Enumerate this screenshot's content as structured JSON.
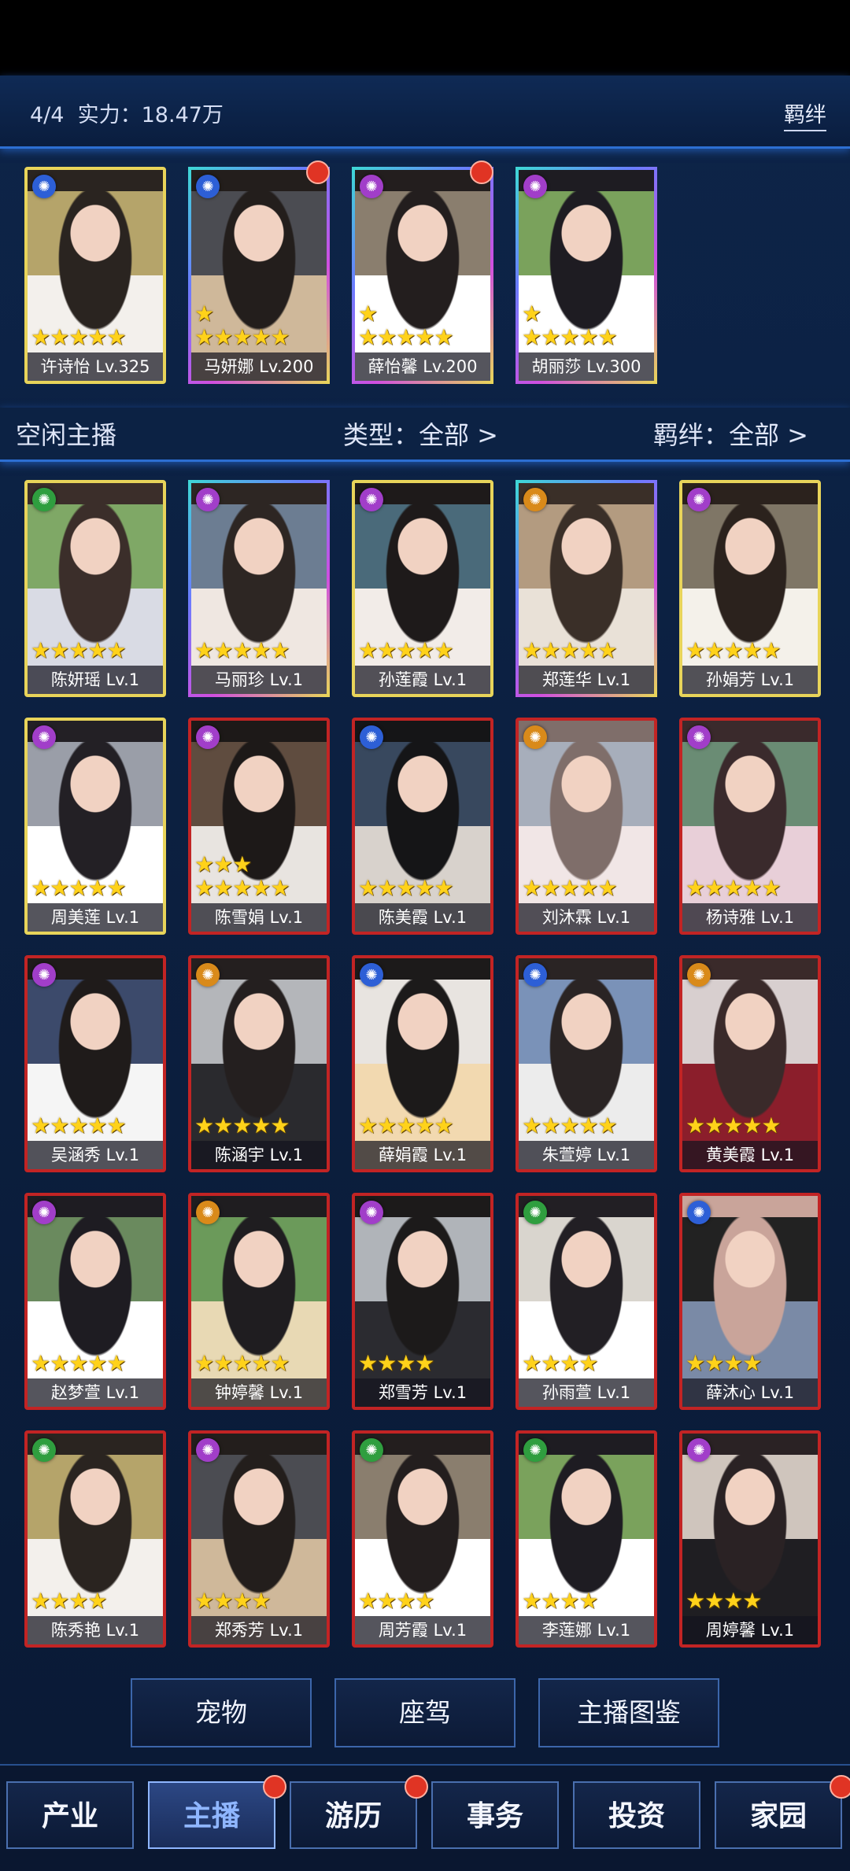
{
  "header": {
    "count": "4/4",
    "power": "实力：18.47万",
    "bond_button": "羁绊"
  },
  "filter": {
    "title": "空闲主播",
    "type": "类型：全部 >",
    "bond": "羁绊：全部 >"
  },
  "colors": {
    "star": "#ffd21a",
    "active_tab": "#8fb6ff",
    "accent_line": "#2d6fd2",
    "badge": "#e03424"
  },
  "assigned": [
    {
      "name": "许诗怡 Lv.325",
      "stars": "★★★★★",
      "element": "blue-element-icon",
      "frame": "gold",
      "badge": false
    },
    {
      "name": "马妍娜 Lv.200",
      "stars": "★\n★★★★★",
      "element": "blue-element-icon",
      "frame": "multi",
      "badge": true
    },
    {
      "name": "薛怡馨 Lv.200",
      "stars": "★\n★★★★★",
      "element": "purple-element-icon",
      "frame": "multi",
      "badge": true
    },
    {
      "name": "胡丽莎 Lv.300",
      "stars": "★\n★★★★★",
      "element": "purple-element-icon",
      "frame": "multi",
      "badge": false
    }
  ],
  "idle": [
    {
      "name": "陈妍瑶 Lv.1",
      "stars": "★★★★★",
      "element": "green",
      "frame": "gold"
    },
    {
      "name": "马丽珍 Lv.1",
      "stars": "★★★★★",
      "element": "purple",
      "frame": "multi"
    },
    {
      "name": "孙莲霞 Lv.1",
      "stars": "★★★★★",
      "element": "purple",
      "frame": "gold"
    },
    {
      "name": "郑莲华 Lv.1",
      "stars": "★★★★★",
      "element": "orange",
      "frame": "multi"
    },
    {
      "name": "孙娟芳 Lv.1",
      "stars": "★★★★★",
      "element": "purple",
      "frame": "gold"
    },
    {
      "name": "周美莲 Lv.1",
      "stars": "★★★★★",
      "element": "purple",
      "frame": "gold"
    },
    {
      "name": "陈雪娟 Lv.1",
      "stars": "★★★\n★★★★★",
      "element": "purple",
      "frame": "red"
    },
    {
      "name": "陈美霞 Lv.1",
      "stars": "★★★★★",
      "element": "blue",
      "frame": "red"
    },
    {
      "name": "刘沐霖 Lv.1",
      "stars": "★★★★★",
      "element": "orange",
      "frame": "red"
    },
    {
      "name": "杨诗雅 Lv.1",
      "stars": "★★★★★",
      "element": "purple",
      "frame": "red"
    },
    {
      "name": "吴涵秀 Lv.1",
      "stars": "★★★★★",
      "element": "purple",
      "frame": "red"
    },
    {
      "name": "陈涵宇 Lv.1",
      "stars": "★★★★★",
      "element": "orange",
      "frame": "red"
    },
    {
      "name": "薛娟霞 Lv.1",
      "stars": "★★★★★",
      "element": "blue",
      "frame": "red"
    },
    {
      "name": "朱萱婷 Lv.1",
      "stars": "★★★★★",
      "element": "blue",
      "frame": "red"
    },
    {
      "name": "黄美霞 Lv.1",
      "stars": "★★★★★",
      "element": "orange",
      "frame": "red"
    },
    {
      "name": "赵梦萱 Lv.1",
      "stars": "★★★★★",
      "element": "purple",
      "frame": "red"
    },
    {
      "name": "钟婷馨 Lv.1",
      "stars": "★★★★★",
      "element": "orange",
      "frame": "red"
    },
    {
      "name": "郑雪芳 Lv.1",
      "stars": "★★★★",
      "element": "purple",
      "frame": "red"
    },
    {
      "name": "孙雨萱 Lv.1",
      "stars": "★★★★",
      "element": "green",
      "frame": "red"
    },
    {
      "name": "薛沐心 Lv.1",
      "stars": "★★★★",
      "element": "blue",
      "frame": "red"
    },
    {
      "name": "陈秀艳 Lv.1",
      "stars": "★★★★",
      "element": "green",
      "frame": "red"
    },
    {
      "name": "郑秀芳 Lv.1",
      "stars": "★★★★",
      "element": "purple",
      "frame": "red"
    },
    {
      "name": "周芳霞 Lv.1",
      "stars": "★★★★",
      "element": "green",
      "frame": "red"
    },
    {
      "name": "李莲娜 Lv.1",
      "stars": "★★★★",
      "element": "green",
      "frame": "red"
    },
    {
      "name": "周婷馨 Lv.1",
      "stars": "★★★★",
      "element": "purple",
      "frame": "red"
    }
  ],
  "actions": {
    "pet": "宠物",
    "mount": "座驾",
    "catalog": "主播图鉴"
  },
  "nav": [
    {
      "label": "产业",
      "active": false,
      "badge": false
    },
    {
      "label": "主播",
      "active": true,
      "badge": true
    },
    {
      "label": "游历",
      "active": false,
      "badge": true
    },
    {
      "label": "事务",
      "active": false,
      "badge": false
    },
    {
      "label": "投资",
      "active": false,
      "badge": false
    },
    {
      "label": "家园",
      "active": false,
      "badge": true
    }
  ]
}
